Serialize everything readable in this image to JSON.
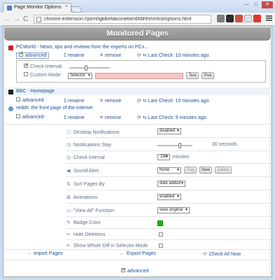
{
  "window": {
    "tab_title": "Page Monitor Options",
    "tab_close": "×",
    "minimize": "—",
    "maximize": "□",
    "close": "✕"
  },
  "toolbar": {
    "back": "←",
    "forward": "→",
    "reload": "C",
    "url": "chrome-extension://pemhgklkefakciniebenbfdihhmmfcd/options.html"
  },
  "extensions": [
    "#7d7d7d",
    "#2b2b2b",
    "#d44b3f",
    "#e0e0e0",
    "#d9382f"
  ],
  "header": {
    "title": "Monitored Pages"
  },
  "actions": {
    "advanced": "advanced",
    "rename": "rename",
    "remove": "remove"
  },
  "pages": [
    {
      "title": "PCWorld - News, tips and reviews from the experts on PCs...",
      "last_check": "Last Check: 10 minutes ago.",
      "favicon_color": "#c8231f",
      "advanced_on": true
    },
    {
      "title": "BBC - Homepage",
      "last_check": "Last Check: 10 minutes ago.",
      "favicon_color": "#222222",
      "advanced_on": false
    },
    {
      "title": "reddit: the front page of the internet",
      "last_check": "Last Check: 9 minutes ago.",
      "favicon_color": "#5f99cf",
      "advanced_on": false
    }
  ],
  "advanced_panel": {
    "check_interval_label": "Check Interval:",
    "custom_mode_label": "Custom Mode:",
    "mode_value": "Selector",
    "test_label": "Test",
    "pick_label": "Pick"
  },
  "settings": {
    "desktop_notifications": {
      "label": "Desktop Notifications",
      "value": "disabled"
    },
    "notifications_stay": {
      "label": "Notifications Stay",
      "value": "30 seconds"
    },
    "check_interval": {
      "label": "Check Interval",
      "value": "180",
      "unit": "minutes"
    },
    "sound_alert": {
      "label": "Sound Alert",
      "value": "None",
      "play": "Play",
      "new": "New",
      "delete": "Delete"
    },
    "sort_pages_by": {
      "label": "Sort Pages By",
      "value": "date added"
    },
    "animations": {
      "label": "Animations",
      "value": "enabled"
    },
    "view_all": {
      "label": "\"View All\" Function",
      "value": "view original"
    },
    "badge_color": {
      "label": "Badge Color",
      "color": "#16b80a"
    },
    "hide_deletions": {
      "label": "Hide Deletions"
    },
    "show_whole_diff": {
      "label": "Show Whole Diff in Selector Mode"
    }
  },
  "footer": {
    "import": "Import Pages",
    "export": "Export Pages",
    "check_all": "Check All Now",
    "advanced": "advanced"
  },
  "icons": {
    "check_now": "⟳",
    "last_check": "⇆",
    "rename": "Ɪ",
    "remove": "✕"
  }
}
